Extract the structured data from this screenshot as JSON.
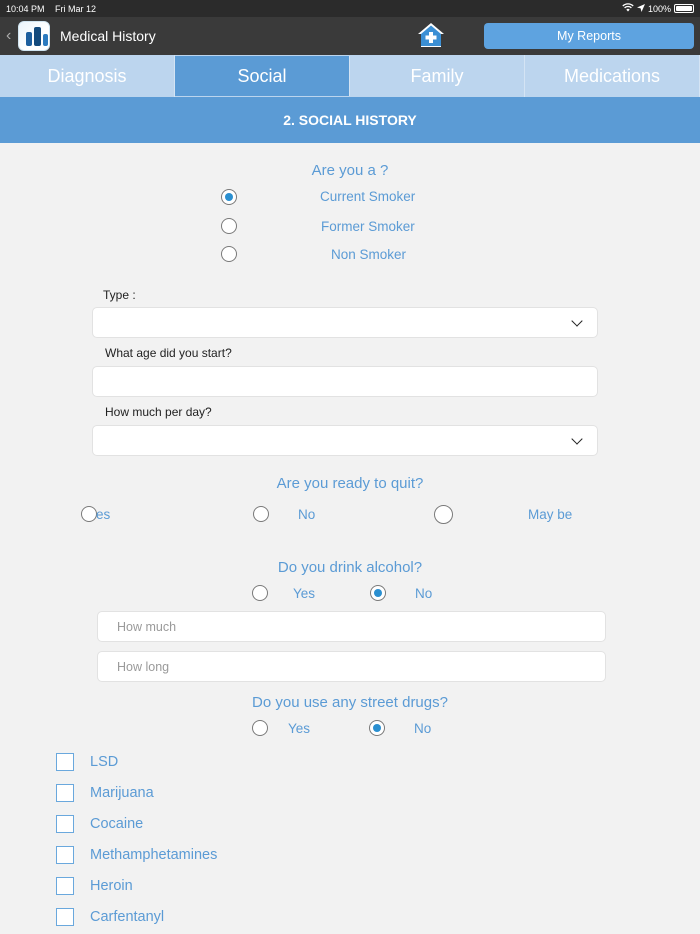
{
  "status_bar": {
    "time": "10:04 PM",
    "date": "Fri Mar 12",
    "battery": "100%"
  },
  "navbar": {
    "title": "Medical History",
    "reports_label": "My Reports"
  },
  "tabs": [
    {
      "label": "Diagnosis"
    },
    {
      "label": "Social"
    },
    {
      "label": "Family"
    },
    {
      "label": "Medications"
    }
  ],
  "active_tab": "Social",
  "section": {
    "title": "2. SOCIAL HISTORY"
  },
  "smoker": {
    "question": "Are you a ?",
    "options": [
      "Current Smoker",
      "Former Smoker",
      "Non Smoker"
    ],
    "selected": "Current Smoker"
  },
  "type_field": {
    "label": "Type :",
    "value": ""
  },
  "age_field": {
    "label": "What age did you start?",
    "value": ""
  },
  "per_day_field": {
    "label": "How much per day?",
    "value": ""
  },
  "quit": {
    "question": "Are you ready to quit?",
    "options": [
      "es",
      "No",
      "May be"
    ]
  },
  "alcohol": {
    "question": "Do you drink alcohol?",
    "options": [
      "Yes",
      "No"
    ],
    "selected": "No",
    "how_much_placeholder": "How much",
    "how_long_placeholder": "How long"
  },
  "drugs": {
    "question": "Do you use any street drugs?",
    "options": [
      "Yes",
      "No"
    ],
    "selected": "No",
    "list": [
      "LSD",
      "Marijuana",
      "Cocaine",
      "Methamphetamines",
      "Heroin",
      "Carfentanyl"
    ]
  },
  "colors": {
    "accent": "#5b9bd5",
    "navbar": "#3a3a3a",
    "radio_fill": "#2a8fd0"
  }
}
